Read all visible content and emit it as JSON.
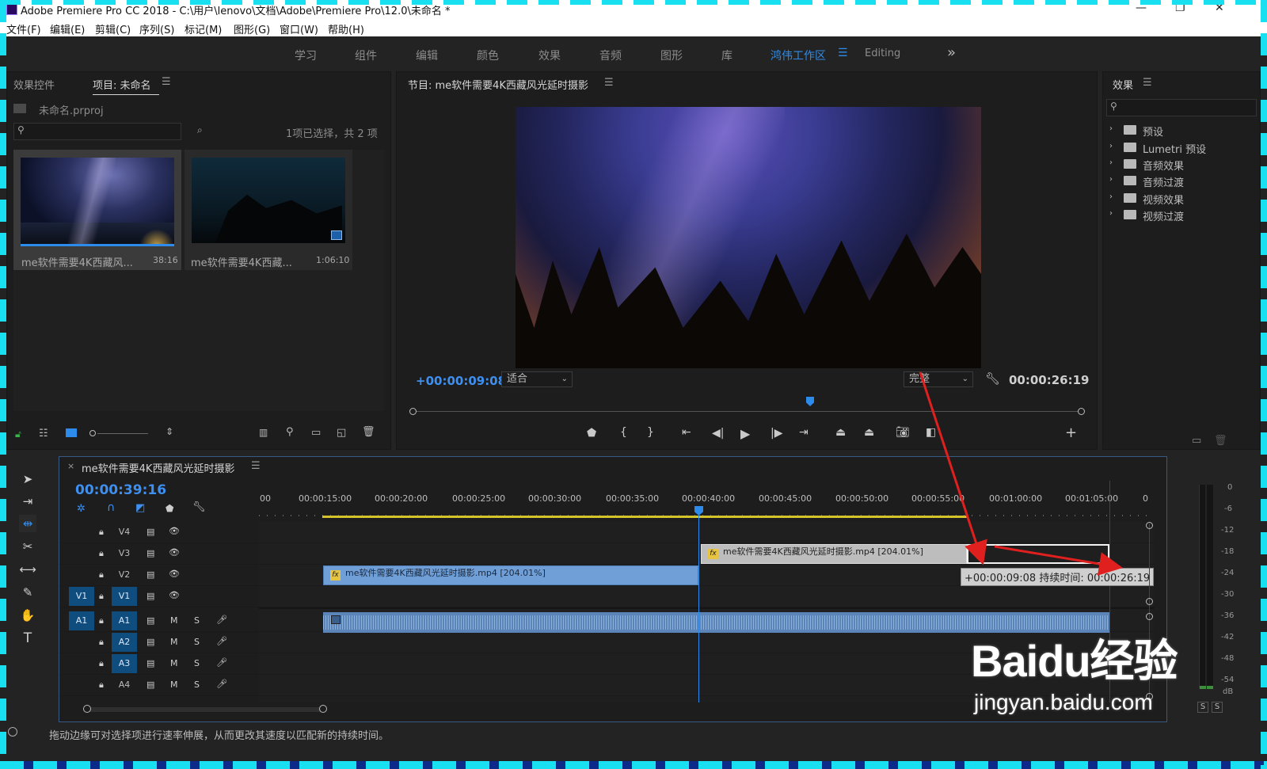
{
  "window": {
    "title": "Adobe Premiere Pro CC 2018 - C:\\用户\\lenovo\\文档\\Adobe\\Premiere Pro\\12.0\\未命名 *"
  },
  "menu": [
    "文件(F)",
    "编辑(E)",
    "剪辑(C)",
    "序列(S)",
    "标记(M)",
    "图形(G)",
    "窗口(W)",
    "帮助(H)"
  ],
  "workspaces": [
    "学习",
    "组件",
    "编辑",
    "颜色",
    "效果",
    "音频",
    "图形",
    "库",
    "鸿伟工作区",
    "Editing"
  ],
  "project_panel": {
    "tabs": [
      "效果控件",
      "项目: 未命名"
    ],
    "file": "未命名.prproj",
    "selection_info": "1项已选择，共 2 项",
    "items": [
      {
        "name": "me软件需要4K西藏风...",
        "duration": "38:16"
      },
      {
        "name": "me软件需要4K西藏...",
        "duration": "1:06:10"
      }
    ]
  },
  "program_monitor": {
    "title": "节目: me软件需要4K西藏风光延时摄影",
    "current_tc": "+00:00:09:08",
    "fit": "适合",
    "quality": "完整",
    "duration_tc": "00:00:26:19"
  },
  "effects_panel": {
    "title": "效果",
    "items": [
      "预设",
      "Lumetri 预设",
      "音频效果",
      "音频过渡",
      "视频效果",
      "视频过渡"
    ]
  },
  "timeline": {
    "sequence_name": "me软件需要4K西藏风光延时摄影",
    "timecode": "00:00:39:16",
    "ruler": [
      "00",
      "00:00:15:00",
      "00:00:20:00",
      "00:00:25:00",
      "00:00:30:00",
      "00:00:35:00",
      "00:00:40:00",
      "00:00:45:00",
      "00:00:50:00",
      "00:00:55:00",
      "00:01:00:00",
      "00:01:05:00",
      "0"
    ],
    "video_tracks": [
      "V4",
      "V3",
      "V2",
      "V1"
    ],
    "audio_tracks": [
      "A1",
      "A2",
      "A3",
      "A4"
    ],
    "patch_v": "V1",
    "patch_a": "A1",
    "mute_label": "M",
    "solo_label": "S",
    "clips": {
      "v3": "me软件需要4K西藏风光延时摄影.mp4 [204.01%]",
      "v2": "me软件需要4K西藏风光延时摄影.mp4 [204.01%]"
    },
    "tooltip": "+00:00:09:08 持续时间: 00:00:26:19",
    "fx_badge": "fx"
  },
  "audio_meter": {
    "scale": [
      "0",
      "-6",
      "-12",
      "-18",
      "-24",
      "-30",
      "-36",
      "-42",
      "-48",
      "-54",
      "dB"
    ],
    "solo_buttons": [
      "S",
      "S"
    ]
  },
  "status_bar": "拖动边缘可对选择项进行速率伸展，从而更改其速度以匹配新的持续时间。",
  "watermark": {
    "main": "Baidu经验",
    "url": "jingyan.baidu.com"
  },
  "colors": {
    "accent": "#2d8ceb",
    "video_clip": "#6f9fd6",
    "patch": "#0e4d7d",
    "arrow": "#e0201e"
  }
}
